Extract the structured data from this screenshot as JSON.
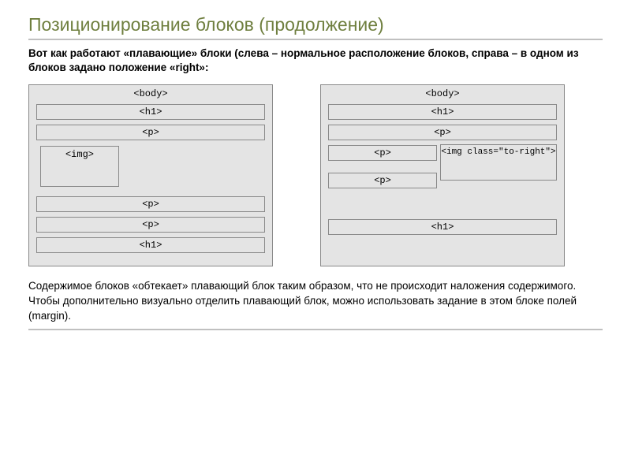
{
  "title": "Позиционирование блоков (продолжение)",
  "intro": "Вот как работают «плавающие» блоки (слева – нормальное расположение блоков, справа – в одном из блоков задано положение «right»:",
  "left": {
    "body": "<body>",
    "h1_top": "<h1>",
    "p1": "<p>",
    "img": "<img>",
    "p2": "<p>",
    "p3": "<p>",
    "h1_bottom": "<h1>"
  },
  "right": {
    "body": "<body>",
    "h1_top": "<h1>",
    "p1": "<p>",
    "p_left": "<p>",
    "img": "<img class=\"to-right\">",
    "p_under": "<p>",
    "h1_bottom": "<h1>"
  },
  "outro": "Содержимое блоков «обтекает» плавающий блок таким образом, что не происходит наложения содержимого. Чтобы дополнительно визуально отделить плавающий блок, можно использовать задание в этом блоке полей (margin)."
}
